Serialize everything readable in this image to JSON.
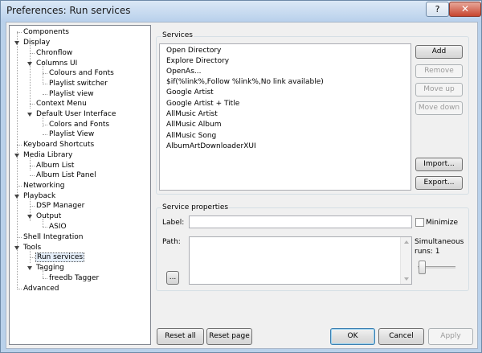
{
  "window": {
    "title": "Preferences: Run services",
    "help_label": "?",
    "close_label": "✕"
  },
  "tree": [
    {
      "label": "Components"
    },
    {
      "label": "Display"
    },
    {
      "label": "Chronflow"
    },
    {
      "label": "Columns UI"
    },
    {
      "label": "Colours and Fonts"
    },
    {
      "label": "Playlist switcher"
    },
    {
      "label": "Playlist view"
    },
    {
      "label": "Context Menu"
    },
    {
      "label": "Default User Interface"
    },
    {
      "label": "Colors and Fonts"
    },
    {
      "label": "Playlist View"
    },
    {
      "label": "Keyboard Shortcuts"
    },
    {
      "label": "Media Library"
    },
    {
      "label": "Album List"
    },
    {
      "label": "Album List Panel"
    },
    {
      "label": "Networking"
    },
    {
      "label": "Playback"
    },
    {
      "label": "DSP Manager"
    },
    {
      "label": "Output"
    },
    {
      "label": "ASIO"
    },
    {
      "label": "Shell Integration"
    },
    {
      "label": "Tools"
    },
    {
      "label": "Run services"
    },
    {
      "label": "Tagging"
    },
    {
      "label": "freedb Tagger"
    },
    {
      "label": "Advanced"
    }
  ],
  "services": {
    "group_label": "Services",
    "items": [
      "Open Directory",
      "Explore Directory",
      "OpenAs...",
      "$if(%link%,Follow %link%,No link available)",
      "Google Artist",
      "Google Artist + Title",
      "AllMusic Artist",
      "AllMusic Album",
      "AllMusic Song",
      "AlbumArtDownloaderXUI"
    ],
    "add_label": "Add",
    "remove_label": "Remove",
    "move_up_label": "Move up",
    "move_down_label": "Move down",
    "import_label": "Import...",
    "export_label": "Export..."
  },
  "props": {
    "group_label": "Service properties",
    "label_label": "Label:",
    "label_value": "",
    "minimize_label": "Minimize",
    "minimize_checked": false,
    "path_label": "Path:",
    "path_value": "",
    "browse_label": "...",
    "simultaneous_label": "Simultaneous",
    "runs_label": "runs: 1",
    "runs_value": 1
  },
  "footer": {
    "reset_all_label": "Reset all",
    "reset_page_label": "Reset page",
    "ok_label": "OK",
    "cancel_label": "Cancel",
    "apply_label": "Apply"
  }
}
